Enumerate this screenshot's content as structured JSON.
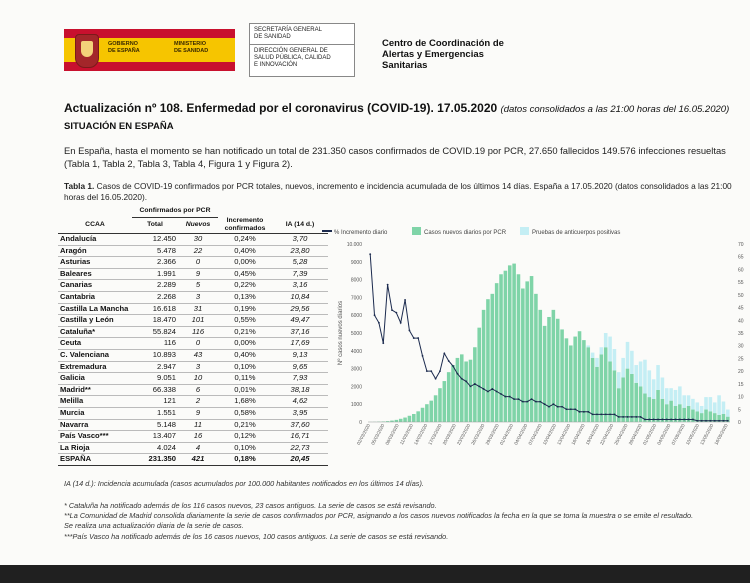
{
  "header": {
    "gov_label": "GOBIERNO\nDE ESPAÑA",
    "ministry_label": "MINISTERIO\nDE SANIDAD",
    "secretaria": "SECRETARÍA GENERAL\nDE SANIDAD",
    "direccion": "DIRECCIÓN GENERAL DE\nSALUD PÚBLICA, CALIDAD\nE INNOVACIÓN",
    "centro": "Centro de Coordinación de\nAlertas y Emergencias\nSanitarias"
  },
  "doc": {
    "title": "Actualización nº 108. Enfermedad por el coronavirus (COVID-19). 17.05.2020",
    "title_note": "(datos consolidados a las 21:00 horas del 16.05.2020)",
    "section": "SITUACIÓN EN ESPAÑA",
    "paragraph": "En España, hasta el momento se han notificado un total de 231.350 casos confirmados de COVID.19 por PCR, 27.650 fallecidos 149.576 infecciones resueltas (Tabla 1, Tabla 2, Tabla 3, Tabla 4, Figura 1 y Figura 2).",
    "table_caption_label": "Tabla 1.",
    "table_caption": "Casos de COVID-19 confirmados por PCR totales, nuevos, incremento e incidencia acumulada de los últimos 14 días. España a 17.05.2020 (datos consolidados a las 21:00 horas del 16.05.2020)."
  },
  "table": {
    "group_header": "Confirmados por PCR",
    "columns": [
      "CCAA",
      "Total",
      "Nuevos",
      "Incremento confirmados",
      "IA (14 d.)"
    ],
    "rows": [
      [
        "Andalucía",
        "12.450",
        "30",
        "0,24%",
        "3,70"
      ],
      [
        "Aragón",
        "5.478",
        "22",
        "0,40%",
        "23,80"
      ],
      [
        "Asturias",
        "2.366",
        "0",
        "0,00%",
        "5,28"
      ],
      [
        "Baleares",
        "1.991",
        "9",
        "0,45%",
        "7,39"
      ],
      [
        "Canarias",
        "2.289",
        "5",
        "0,22%",
        "3,16"
      ],
      [
        "Cantabria",
        "2.268",
        "3",
        "0,13%",
        "10,84"
      ],
      [
        "Castilla La Mancha",
        "16.618",
        "31",
        "0,19%",
        "29,56"
      ],
      [
        "Castilla y León",
        "18.470",
        "101",
        "0,55%",
        "49,47"
      ],
      [
        "Cataluña*",
        "55.824",
        "116",
        "0,21%",
        "37,16"
      ],
      [
        "Ceuta",
        "116",
        "0",
        "0,00%",
        "17,69"
      ],
      [
        "C. Valenciana",
        "10.893",
        "43",
        "0,40%",
        "9,13"
      ],
      [
        "Extremadura",
        "2.947",
        "3",
        "0,10%",
        "9,65"
      ],
      [
        "Galicia",
        "9.051",
        "10",
        "0,11%",
        "7,93"
      ],
      [
        "Madrid**",
        "66.338",
        "6",
        "0,01%",
        "38,18"
      ],
      [
        "Melilla",
        "121",
        "2",
        "1,68%",
        "4,62"
      ],
      [
        "Murcia",
        "1.551",
        "9",
        "0,58%",
        "3,95"
      ],
      [
        "Navarra",
        "5.148",
        "11",
        "0,21%",
        "37,60"
      ],
      [
        "País Vasco***",
        "13.407",
        "16",
        "0,12%",
        "16,71"
      ],
      [
        "La Rioja",
        "4.024",
        "4",
        "0,10%",
        "22,73"
      ]
    ],
    "total": [
      "ESPAÑA",
      "231.350",
      "421",
      "0,18%",
      "20,45"
    ]
  },
  "chart_data": {
    "type": "bar",
    "title": "",
    "ylabel": "Nº casos nuevos diarios",
    "ylim": [
      0,
      10000
    ],
    "y2lim": [
      0,
      70
    ],
    "y_ticks": [
      "0",
      "1000",
      "2000",
      "3000",
      "4000",
      "5000",
      "6000",
      "7000",
      "8000",
      "9000",
      "10.000"
    ],
    "y2_ticks": [
      "0",
      "5",
      "10",
      "15",
      "20",
      "25",
      "30",
      "35",
      "40",
      "45",
      "50",
      "55",
      "60",
      "65",
      "70"
    ],
    "x_ticks": [
      "02/03/2020",
      "05/03/2020",
      "08/03/2020",
      "11/03/2020",
      "14/03/2020",
      "17/03/2020",
      "20/03/2020",
      "23/03/2020",
      "26/03/2020",
      "29/03/2020",
      "01/04/2020",
      "04/04/2020",
      "07/04/2020",
      "10/04/2020",
      "13/04/2020",
      "16/04/2020",
      "19/04/2020",
      "22/04/2020",
      "25/04/2020",
      "28/04/2020",
      "01/05/2020",
      "04/05/2020",
      "07/05/2020",
      "10/05/2020",
      "13/05/2020",
      "16/05/2020"
    ],
    "legend_position": "top",
    "series": [
      {
        "name": "Casos nuevos diarios por PCR",
        "kind": "bar",
        "color": "#7fd4a8",
        "values": [
          5,
          10,
          20,
          30,
          50,
          80,
          120,
          180,
          250,
          350,
          450,
          600,
          800,
          1000,
          1200,
          1500,
          1900,
          2300,
          2800,
          3200,
          3600,
          3800,
          3400,
          3500,
          4200,
          5300,
          6300,
          6900,
          7200,
          7800,
          8300,
          8500,
          8800,
          8900,
          8300,
          7500,
          7900,
          8200,
          7200,
          6300,
          5400,
          5900,
          6300,
          5800,
          5200,
          4700,
          4300,
          4800,
          5100,
          4600,
          4200,
          3600,
          3100,
          3800,
          4200,
          3400,
          2900,
          1900,
          2500,
          3000,
          2700,
          2200,
          2000,
          1600,
          1400,
          1300,
          1800,
          1300,
          1000,
          1200,
          900,
          1000,
          800,
          900,
          700,
          600,
          500,
          700,
          600,
          500,
          400,
          450,
          300
        ]
      },
      {
        "name": "Pruebas de anticuerpos positivas",
        "kind": "bar",
        "color": "#c4eef4",
        "values": [
          0,
          0,
          0,
          0,
          0,
          0,
          0,
          0,
          0,
          0,
          0,
          0,
          0,
          0,
          0,
          0,
          0,
          0,
          0,
          0,
          0,
          0,
          0,
          0,
          0,
          0,
          0,
          0,
          0,
          0,
          0,
          0,
          0,
          0,
          0,
          0,
          0,
          0,
          0,
          0,
          0,
          0,
          0,
          0,
          0,
          0,
          0,
          0,
          0,
          0,
          100,
          300,
          500,
          400,
          800,
          1400,
          1200,
          900,
          1100,
          1500,
          1300,
          1000,
          1400,
          1900,
          1500,
          1100,
          1400,
          1200,
          900,
          700,
          900,
          1000,
          700,
          600,
          600,
          500,
          400,
          700,
          800,
          600,
          1100,
          700,
          400
        ]
      },
      {
        "name": "% Incremento diario",
        "kind": "line",
        "axis": "right",
        "color": "#1b2a4e",
        "values": [
          66,
          42,
          39,
          31,
          54,
          44,
          43,
          39,
          48,
          36,
          33,
          33,
          26,
          20,
          20,
          17,
          20,
          27,
          24,
          22,
          19,
          17,
          16,
          14,
          15,
          14,
          13,
          12,
          13,
          12,
          11,
          10,
          10,
          9,
          9,
          8,
          8,
          9,
          8,
          8,
          7,
          6,
          7,
          6,
          6,
          5,
          5,
          5,
          4,
          4,
          4,
          3,
          3,
          3,
          3,
          3,
          3,
          2,
          2,
          2,
          2,
          2,
          2,
          1,
          1,
          1,
          1,
          1,
          1,
          1,
          1,
          1,
          1,
          1,
          1,
          0.5,
          0.5,
          0.5,
          0.5,
          0.5,
          0.5,
          0.5,
          0.5
        ]
      }
    ]
  },
  "footnotes": [
    "IA (14 d.): Incidencia acumulada (casos acumulados por 100.000 habitantes notificados en los últimos 14 días).",
    "* Cataluña ha notificado además de los 116 casos nuevos, 23 casos antiguos. La serie de casos se está revisando.",
    "**La Comunidad de Madrid consolida diariamente la serie de casos confirmados por PCR, asignando a los casos nuevos notificados la fecha en la que se toma la muestra o se emite el resultado.",
    "Se realiza una actualización diaria de la serie de casos.",
    "***País Vasco ha notificado además de los 16 casos nuevos, 100 casos antiguos. La serie de casos se está revisando."
  ]
}
